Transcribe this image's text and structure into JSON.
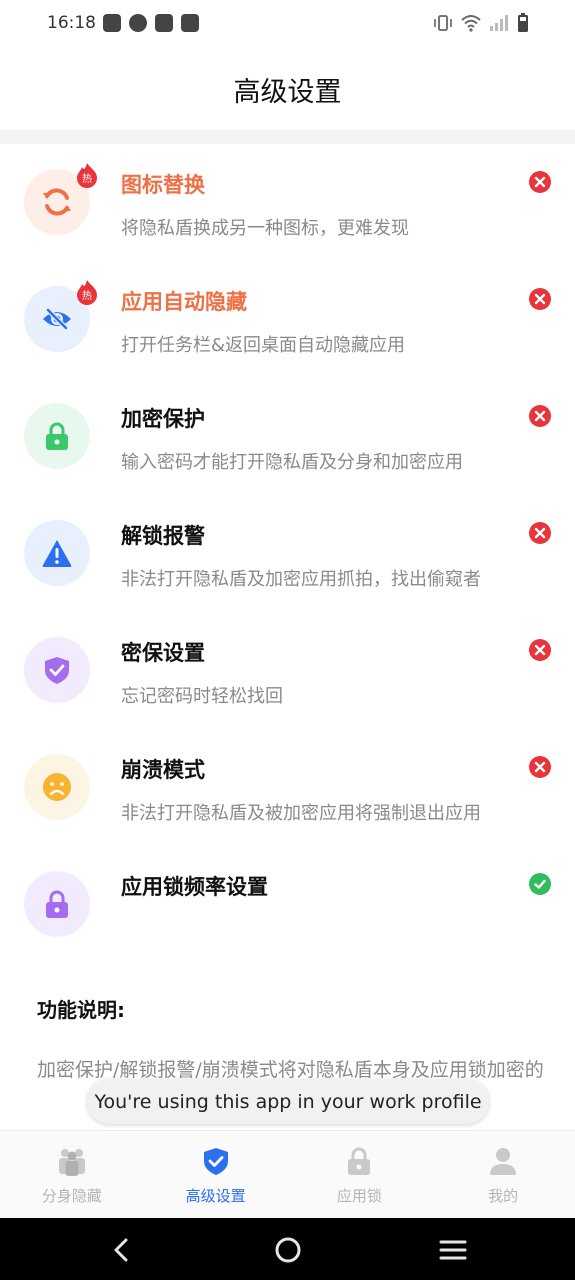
{
  "status_bar": {
    "time": "16:18",
    "notification_icons": [
      "mail-icon",
      "check-circle-icon",
      "calendar-icon",
      "gallery-icon"
    ],
    "system_icons": [
      "vibrate-icon",
      "wifi-icon",
      "signal-icon",
      "battery-icon"
    ]
  },
  "header": {
    "title": "高级设置"
  },
  "settings": [
    {
      "title": "图标替换",
      "desc": "将隐私盾换成另一种图标，更难发现",
      "hot": true,
      "hot_label": "热",
      "enabled": false,
      "icon": "refresh-icon",
      "icon_color": "#f07045",
      "bg_color": "#fdeee8"
    },
    {
      "title": "应用自动隐藏",
      "desc": "打开任务栏&返回桌面自动隐藏应用",
      "hot": true,
      "hot_label": "热",
      "enabled": false,
      "icon": "eye-off-icon",
      "icon_color": "#2b6ff2",
      "bg_color": "#e8f0fd"
    },
    {
      "title": "加密保护",
      "desc": "输入密码才能打开隐私盾及分身和加密应用",
      "hot": false,
      "enabled": false,
      "icon": "lock-icon",
      "icon_color": "#3cc76a",
      "bg_color": "#e9f8ee"
    },
    {
      "title": "解锁报警",
      "desc": "非法打开隐私盾及加密应用抓拍，找出偷窥者",
      "hot": false,
      "enabled": false,
      "icon": "warning-icon",
      "icon_color": "#2b6ff2",
      "bg_color": "#e8f0fd"
    },
    {
      "title": "密保设置",
      "desc": "忘记密码时轻松找回",
      "hot": false,
      "enabled": false,
      "icon": "shield-check-icon",
      "icon_color": "#a66cf0",
      "bg_color": "#f2ebfd"
    },
    {
      "title": "崩溃模式",
      "desc": "非法打开隐私盾及被加密应用将强制退出应用",
      "hot": false,
      "enabled": false,
      "icon": "sad-face-icon",
      "icon_color": "#f5b530",
      "bg_color": "#fdf5e4"
    },
    {
      "title": "应用锁频率设置",
      "desc": "",
      "hot": false,
      "enabled": true,
      "icon": "padlock-icon",
      "icon_color": "#a66cf0",
      "bg_color": "#f2ebfd"
    }
  ],
  "description": {
    "title": "功能说明:",
    "text": "加密保护/解锁报警/崩溃模式将对隐私盾本身及应用锁加密的"
  },
  "toast": {
    "text": "You're using this app in your work profile"
  },
  "tabs": [
    {
      "label": "分身隐藏",
      "icon": "clone-icon",
      "active": false
    },
    {
      "label": "高级设置",
      "icon": "shield-check-icon",
      "active": true
    },
    {
      "label": "应用锁",
      "icon": "lock-icon",
      "active": false
    },
    {
      "label": "我的",
      "icon": "person-icon",
      "active": false
    }
  ],
  "colors": {
    "accent": "#2b6ff2",
    "hot": "#f07045",
    "off": "#e8343a",
    "on": "#2fbd5e"
  }
}
